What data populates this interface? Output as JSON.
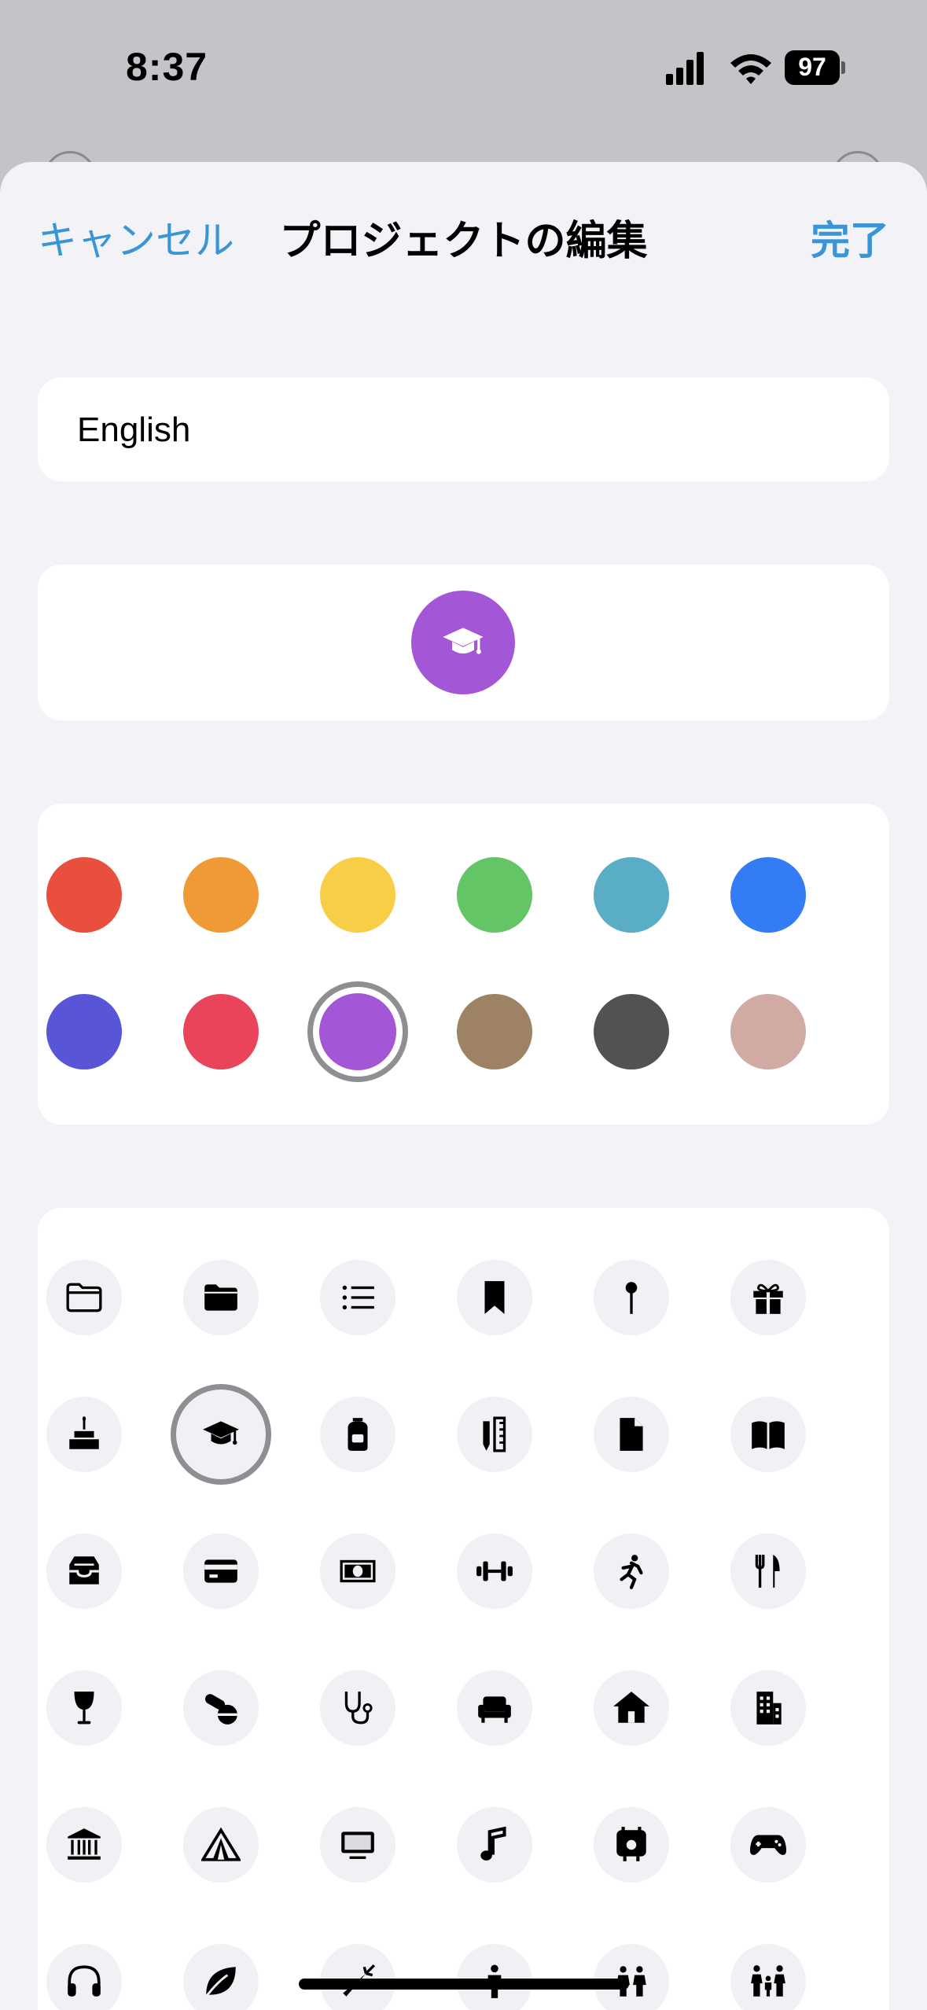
{
  "status_bar": {
    "time": "8:37",
    "battery": "97"
  },
  "nav": {
    "cancel": "キャンセル",
    "title": "プロジェクトの編集",
    "done": "完了"
  },
  "name_field": {
    "value": "English"
  },
  "preview": {
    "color": "#a356d6",
    "icon": "graduation-cap-icon"
  },
  "colors": {
    "selected_index": 8,
    "swatches": [
      "#e94f3d",
      "#f09a37",
      "#f7ce46",
      "#63c565",
      "#59adc4",
      "#347cf5",
      "#5855d6",
      "#e9445a",
      "#a356d6",
      "#9d8263",
      "#525252",
      "#d0aaa3"
    ]
  },
  "icons": {
    "selected_index": 7,
    "items": [
      "folder-icon",
      "folder-filled-icon",
      "list-icon",
      "bookmark-icon",
      "pin-icon",
      "gift-icon",
      "birthday-cake-icon",
      "graduation-cap-icon",
      "backpack-icon",
      "pencil-ruler-icon",
      "document-icon",
      "book-icon",
      "tray-icon",
      "credit-card-icon",
      "banknote-icon",
      "dumbbell-icon",
      "running-figure-icon",
      "fork-knife-icon",
      "wine-glass-icon",
      "pills-icon",
      "stethoscope-icon",
      "armchair-icon",
      "house-icon",
      "building-icon",
      "bank-icon",
      "tent-icon",
      "monitor-icon",
      "music-note-icon",
      "apple-display-icon",
      "gamecontroller-icon",
      "headphones-icon",
      "leaf-icon",
      "carrot-icon",
      "person-icon",
      "two-people-icon",
      "family-icon"
    ]
  }
}
